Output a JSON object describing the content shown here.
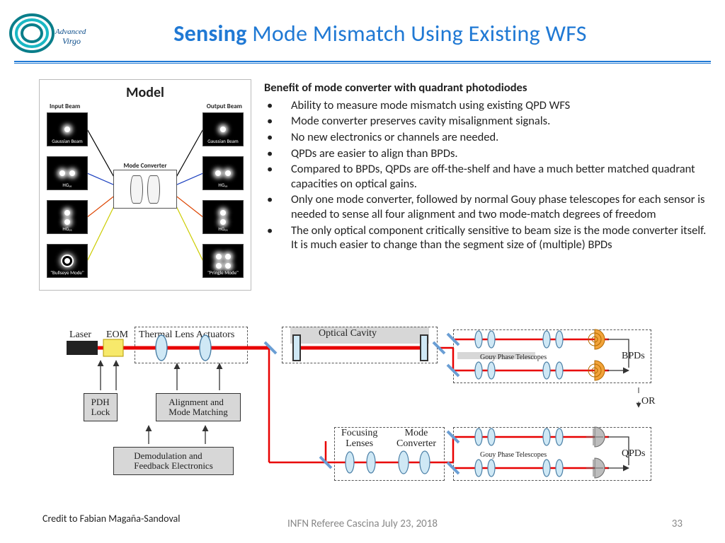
{
  "logo": {
    "primary": "Advanced",
    "secondary": "Virgo"
  },
  "title": {
    "bold": "Sensing",
    "rest": " Mode Mismatch Using Existing WFS"
  },
  "model": {
    "title": "Model",
    "inputHeader": "Input Beam",
    "outputHeader": "Output Beam",
    "mcLabel": "Mode Converter",
    "leftTiles": [
      "Gaussian Beam",
      "HG₁₀",
      "HG₀₁",
      "\"Bullseye Mode\""
    ],
    "rightTiles": [
      "Gaussian Beam",
      "HG₁₀",
      "HG₀₁",
      "\"Pringle Mode\""
    ]
  },
  "bullets": {
    "heading": "Benefit of mode converter with quadrant photodiodes",
    "items": [
      "Ability to measure mode mismatch using existing QPD WFS",
      "Mode converter preserves cavity misalignment signals.",
      "No new electronics or channels are needed.",
      "QPDs are easier to align than BPDs.",
      "Compared to BPDs, QPDs are off-the-shelf and have a much better matched quadrant capacities on optical gains.",
      "Only one mode converter, followed by normal Gouy phase telescopes for each sensor is needed to sense all four alignment and two mode-match degrees of freedom",
      "The only optical component critically sensitive to beam size is the mode converter itself. It is much easier to change than the segment size of (multiple) BPDs"
    ]
  },
  "optics": {
    "laser": "Laser",
    "eom": "EOM",
    "thermal": "Thermal Lens Actuators",
    "pdh": "PDH\nLock",
    "align": "Alignment and\nMode Matching",
    "demod": "Demodulation and\nFeedback Electronics",
    "cavity": "Optical Cavity",
    "gouy1": "Gouy Phase Telescopes",
    "gouy2": "Gouy Phase Telescopes",
    "bpds": "BPDs",
    "qpds": "QPDs",
    "focus": "Focusing\nLenses",
    "mc": "Mode\nConverter",
    "or": "OR"
  },
  "credit": "Credit to Fabian Magaña-Sandoval",
  "footer": "INFN Referee  Cascina  July  23,  2018",
  "page": "33"
}
